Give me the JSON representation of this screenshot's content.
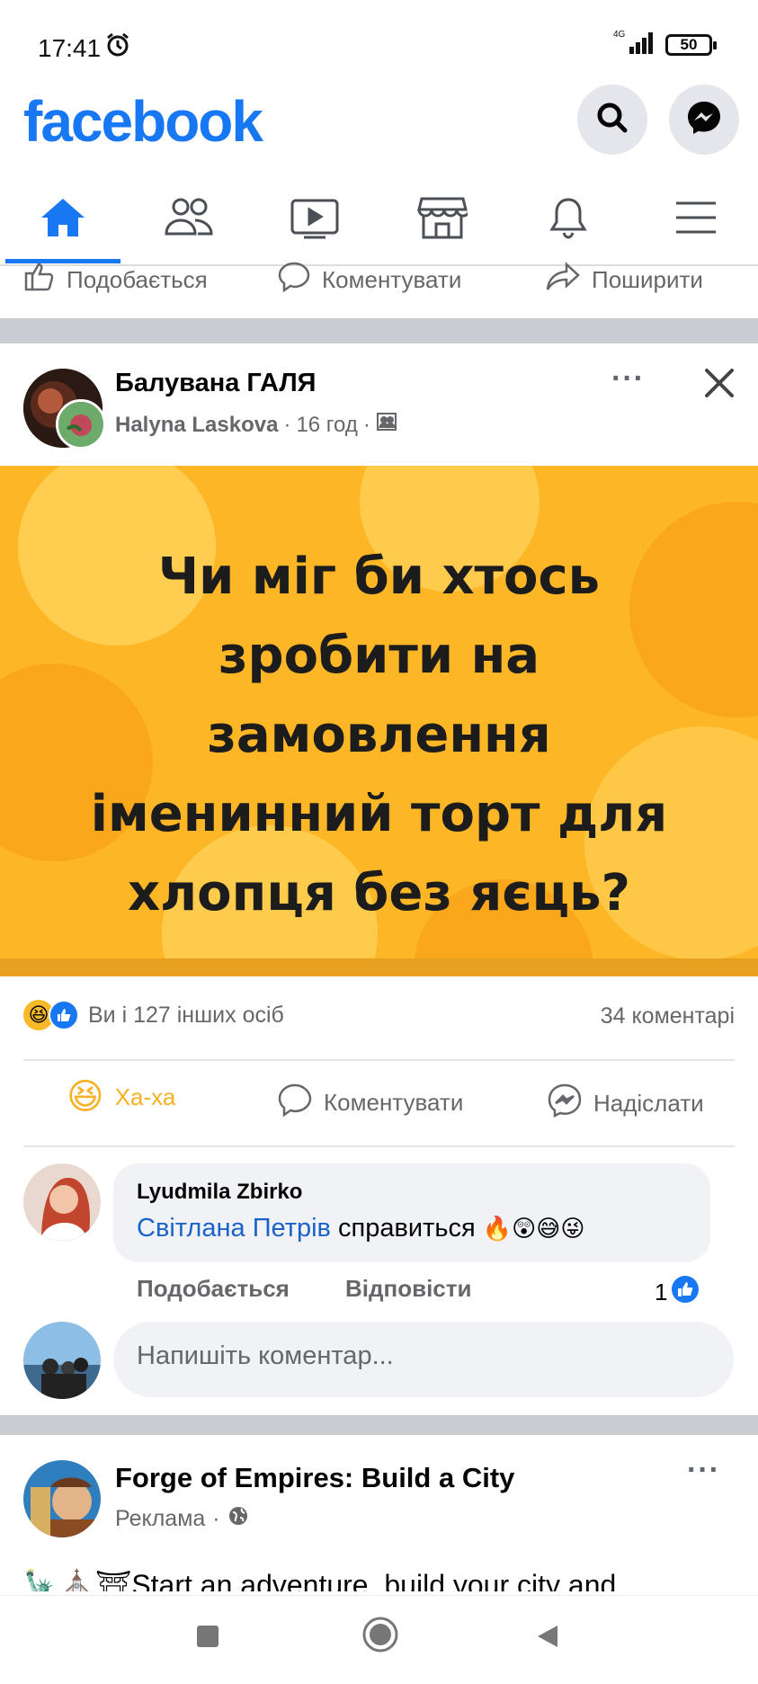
{
  "status_bar": {
    "time": "17:41",
    "network": "4G",
    "battery": "50"
  },
  "header": {
    "logo": "facebook",
    "search_icon": "search-icon",
    "messenger_icon": "messenger-icon"
  },
  "tabs": [
    {
      "name": "home",
      "icon": "home-icon",
      "active": true
    },
    {
      "name": "friends",
      "icon": "friends-icon",
      "active": false
    },
    {
      "name": "watch",
      "icon": "video-icon",
      "active": false
    },
    {
      "name": "marketplace",
      "icon": "store-icon",
      "active": false
    },
    {
      "name": "notifications",
      "icon": "bell-icon",
      "active": false
    },
    {
      "name": "menu",
      "icon": "menu-icon",
      "active": false
    }
  ],
  "top_actions": {
    "like": "Подобається",
    "comment": "Коментувати",
    "share": "Поширити"
  },
  "post": {
    "group": "Балувана ГАЛЯ",
    "author": "Halyna Laskova",
    "time": "16 год",
    "image_text": [
      "Чи міг би хтось",
      "зробити на",
      "замовлення",
      "іменинний торт для",
      "хлопця без яєць?"
    ],
    "reactions_summary": "Ви і 127 інших осіб",
    "comments_count": "34 коментарі",
    "actions": {
      "reaction": "Ха-ха",
      "comment": "Коментувати",
      "send": "Надіслати"
    },
    "accent": "#1877f2"
  },
  "comment": {
    "author": "Lyudmila Zbirko",
    "mention": "Світлана Петрів",
    "text": "справиться",
    "emojis": "🔥😲😅😜",
    "like_label": "Подобається",
    "reply_label": "Відповісти",
    "like_count": "1"
  },
  "write_comment": {
    "placeholder": "Напишіть коментар..."
  },
  "ad": {
    "title": "Forge of Empires: Build a City",
    "label": "Реклама",
    "text": "Start an adventure, build your city and"
  }
}
